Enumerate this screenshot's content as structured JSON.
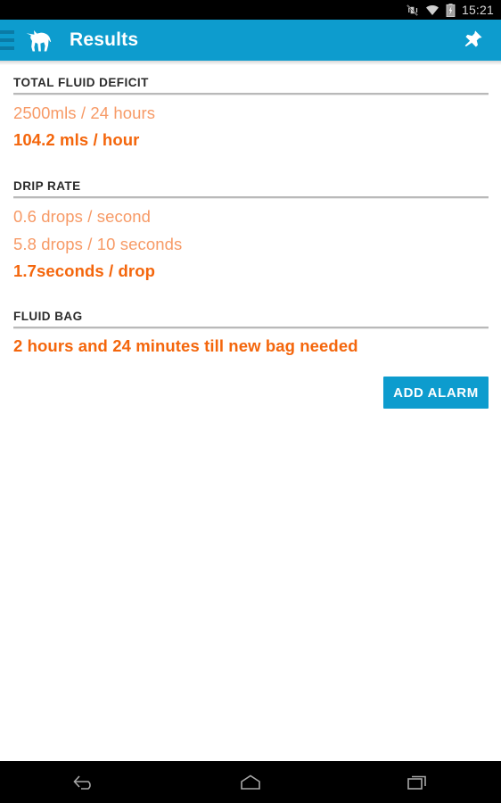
{
  "status_bar": {
    "icons": [
      {
        "name": "vibrate-muted-icon",
        "label": "silent"
      },
      {
        "name": "wifi-icon",
        "label": "wifi"
      },
      {
        "name": "battery-charging-icon",
        "label": "battery charging"
      }
    ],
    "time": "15:21"
  },
  "app_bar": {
    "menu_icon": "hamburger-menu-icon",
    "logo_icon": "dog-logo-icon",
    "title": "Results",
    "action_icon": "pin-icon"
  },
  "sections": [
    {
      "id": "total-fluid-deficit",
      "title": "TOTAL FLUID DEFICIT",
      "rows": [
        {
          "text": "2500mls / 24 hours",
          "emphasis": "light"
        },
        {
          "text": "104.2 mls / hour",
          "emphasis": "strong"
        }
      ]
    },
    {
      "id": "drip-rate",
      "title": "DRIP RATE",
      "rows": [
        {
          "text": "0.6 drops / second",
          "emphasis": "light"
        },
        {
          "text": "5.8 drops / 10 seconds",
          "emphasis": "light"
        },
        {
          "text": "1.7seconds / drop",
          "emphasis": "strong"
        }
      ]
    },
    {
      "id": "fluid-bag",
      "title": "FLUID BAG",
      "rows": [
        {
          "text": "2 hours and 24 minutes till new bag needed",
          "emphasis": "strong"
        }
      ]
    }
  ],
  "add_alarm_button": {
    "label": "ADD ALARM"
  },
  "nav_bar": {
    "buttons": [
      {
        "name": "back-icon",
        "label": "Back"
      },
      {
        "name": "home-icon",
        "label": "Home"
      },
      {
        "name": "recents-icon",
        "label": "Recent apps"
      }
    ]
  },
  "colors": {
    "accent_blue": "#0d9cce",
    "text_orange_light": "#f79a66",
    "text_orange_strong": "#f4660c",
    "status_bar_bg": "#000000",
    "content_bg": "#ffffff"
  }
}
